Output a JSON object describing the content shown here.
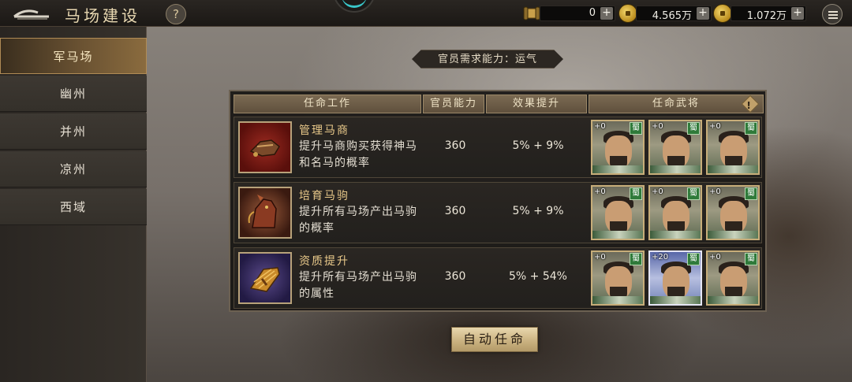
{
  "header": {
    "title": "马场建设",
    "help_label": "?",
    "resources": [
      {
        "icon": "scroll-icon",
        "value": "0",
        "plus": "+"
      },
      {
        "icon": "copper-coin-icon",
        "value": "4.565万",
        "plus": "+"
      },
      {
        "icon": "gold-coin-icon",
        "value": "1.072万",
        "plus": "+"
      }
    ]
  },
  "sidebar": {
    "items": [
      {
        "label": "军马场",
        "active": true
      },
      {
        "label": "幽州",
        "active": false
      },
      {
        "label": "并州",
        "active": false
      },
      {
        "label": "凉州",
        "active": false
      },
      {
        "label": "西域",
        "active": false
      }
    ]
  },
  "requirement": "官员需求能力：运气",
  "table": {
    "headers": [
      "任命工作",
      "官员能力",
      "效果提升",
      "任命武将"
    ],
    "rows": [
      {
        "icon": "saddle-icon",
        "name": "管理马商",
        "desc": "提升马商购买获得神马和名马的概率",
        "ability": "360",
        "effect": "5% + 9%",
        "generals": [
          {
            "level": "+0",
            "kingdom": "蜀"
          },
          {
            "level": "+0",
            "kingdom": "蜀"
          },
          {
            "level": "+0",
            "kingdom": "蜀"
          }
        ]
      },
      {
        "icon": "horse-icon",
        "name": "培育马驹",
        "desc": "提升所有马场产出马驹的概率",
        "ability": "360",
        "effect": "5% + 9%",
        "generals": [
          {
            "level": "+0",
            "kingdom": "蜀"
          },
          {
            "level": "+0",
            "kingdom": "蜀"
          },
          {
            "level": "+0",
            "kingdom": "蜀"
          }
        ]
      },
      {
        "icon": "hay-bundle-icon",
        "name": "资质提升",
        "desc": "提升所有马场产出马驹的属性",
        "ability": "360",
        "effect": "5% + 54%",
        "generals": [
          {
            "level": "+0",
            "kingdom": "蜀"
          },
          {
            "level": "+20",
            "kingdom": "蜀"
          },
          {
            "level": "+0",
            "kingdom": "蜀"
          }
        ]
      }
    ]
  },
  "auto_button": "自动任命"
}
